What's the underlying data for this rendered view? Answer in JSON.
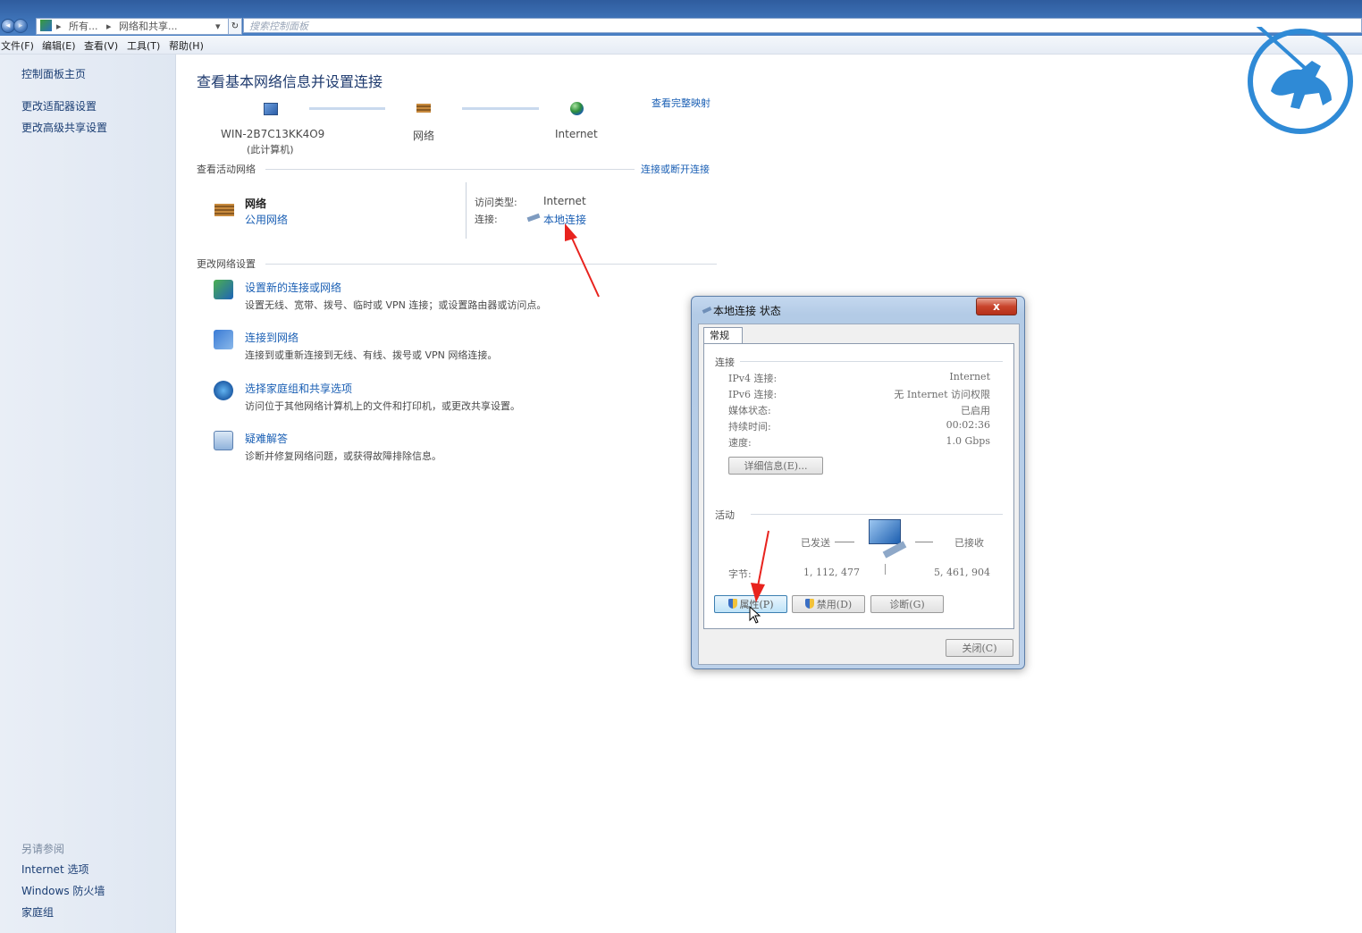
{
  "address_bar": {
    "breadcrumb": [
      "所有...",
      "网络和共享..."
    ],
    "search_placeholder": "搜索控制面板"
  },
  "menu": [
    "文件(F)",
    "编辑(E)",
    "查看(V)",
    "工具(T)",
    "帮助(H)"
  ],
  "sidebar": {
    "links": [
      "控制面板主页",
      "更改适配器设置",
      "更改高级共享设置"
    ],
    "see_also_heading": "另请参阅",
    "see_also": [
      "Internet 选项",
      "Windows 防火墙",
      "家庭组"
    ]
  },
  "main": {
    "title": "查看基本网络信息并设置连接",
    "view_full_map": "查看完整映射",
    "map": {
      "computer_name": "WIN-2B7C13KK4O9",
      "computer_sub": "(此计算机)",
      "network": "网络",
      "internet": "Internet"
    },
    "active_heading": "查看活动网络",
    "connect_disconnect": "连接或断开连接",
    "active_network": {
      "name": "网络",
      "type": "公用网络",
      "access_label": "访问类型:",
      "access_value": "Internet",
      "conn_label": "连接:",
      "conn_value": "本地连接"
    },
    "change_heading": "更改网络设置",
    "tasks": [
      {
        "title": "设置新的连接或网络",
        "desc": "设置无线、宽带、拨号、临时或 VPN 连接；或设置路由器或访问点。"
      },
      {
        "title": "连接到网络",
        "desc": "连接到或重新连接到无线、有线、拨号或 VPN 网络连接。"
      },
      {
        "title": "选择家庭组和共享选项",
        "desc": "访问位于其他网络计算机上的文件和打印机，或更改共享设置。"
      },
      {
        "title": "疑难解答",
        "desc": "诊断并修复网络问题，或获得故障排除信息。"
      }
    ]
  },
  "dialog": {
    "title": "本地连接 状态",
    "close_glyph": "x",
    "tab": "常规",
    "connection_heading": "连接",
    "rows": [
      {
        "label": "IPv4 连接:",
        "value": "Internet"
      },
      {
        "label": "IPv6 连接:",
        "value": "无 Internet 访问权限"
      },
      {
        "label": "媒体状态:",
        "value": "已启用"
      },
      {
        "label": "持续时间:",
        "value": "00:02:36"
      },
      {
        "label": "速度:",
        "value": "1.0 Gbps"
      }
    ],
    "details_button": "详细信息(E)...",
    "activity_heading": "活动",
    "sent_label": "已发送",
    "received_label": "已接收",
    "bytes_label": "字节:",
    "bytes_sent": "1, 112, 477",
    "bytes_received": "5, 461, 904",
    "properties_button": "属性(P)",
    "disable_button": "禁用(D)",
    "diagnose_button": "诊断(G)",
    "close_button": "关闭(C)"
  },
  "colors": {
    "link": "#1a5fb4",
    "title_bar": "#3e73b8",
    "arrow": "#e8231e",
    "logo": "#2f8ad6"
  }
}
